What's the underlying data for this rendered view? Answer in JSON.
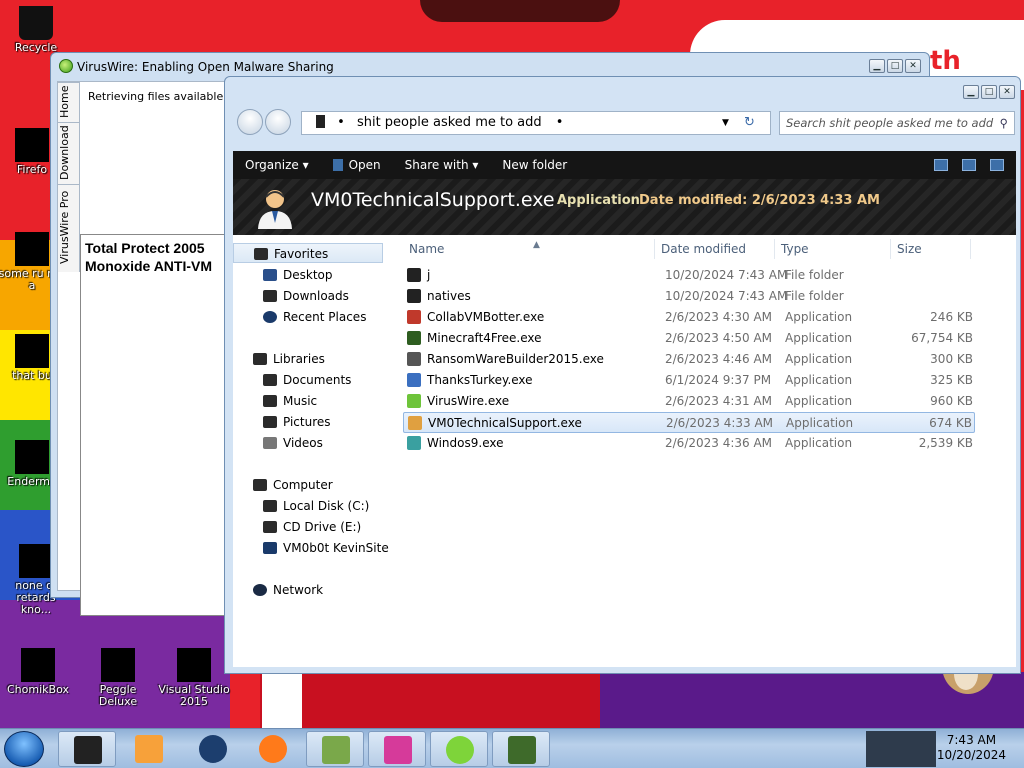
{
  "desktop": {
    "wallpaper_text": "th",
    "icons": [
      {
        "label": "Recycle"
      },
      {
        "label": "Firefo"
      },
      {
        "label": "some ru ran a"
      },
      {
        "label": "that bu"
      },
      {
        "label": "Enderma"
      },
      {
        "label": "none of retards kno..."
      },
      {
        "label": "ChomikBox"
      },
      {
        "label": "Peggle Deluxe"
      },
      {
        "label": "Visual Studio 2015"
      }
    ]
  },
  "viruswire": {
    "title": "VirusWire: Enabling Open Malware Sharing",
    "tabs": [
      "Home",
      "Download",
      "VirusWire Pro"
    ],
    "retrieving": "Retrieving files available, plea",
    "panel_text": "Total Protect 2005\nMonoxide ANTI-VM"
  },
  "explorer": {
    "address": {
      "path": "shit people asked me to add"
    },
    "search_placeholder": "Search shit people asked me to add",
    "toolbar": {
      "organize": "Organize ▾",
      "open": "Open",
      "share_with": "Share with ▾",
      "new_folder": "New folder"
    },
    "details": {
      "filename": "VM0TechnicalSupport.exe",
      "type": "Application",
      "date_modified": "Date modified: 2/6/2023 4:33 AM"
    },
    "nav": {
      "favorites": "Favorites",
      "desktop": "Desktop",
      "downloads": "Downloads",
      "recent": "Recent Places",
      "libraries": "Libraries",
      "documents": "Documents",
      "music": "Music",
      "pictures": "Pictures",
      "videos": "Videos",
      "computer": "Computer",
      "local_disk": "Local Disk (C:)",
      "cd_drive": "CD Drive (E:)",
      "kevinsite": "VM0b0t KevinSite",
      "network": "Network"
    },
    "columns": {
      "name": "Name",
      "date": "Date modified",
      "type": "Type",
      "size": "Size"
    },
    "files": [
      {
        "name": "j",
        "date": "10/20/2024 7:43 AM",
        "type": "File folder",
        "size": "",
        "icon": "folder-icon"
      },
      {
        "name": "natives",
        "date": "10/20/2024 7:43 AM",
        "type": "File folder",
        "size": "",
        "icon": "folder-icon"
      },
      {
        "name": "CollabVMBotter.exe",
        "date": "2/6/2023 4:30 AM",
        "type": "Application",
        "size": "246 KB",
        "icon": "app-icon"
      },
      {
        "name": "Minecraft4Free.exe",
        "date": "2/6/2023 4:50 AM",
        "type": "Application",
        "size": "67,754 KB",
        "icon": "app-icon"
      },
      {
        "name": "RansomWareBuilder2015.exe",
        "date": "2/6/2023 4:46 AM",
        "type": "Application",
        "size": "300 KB",
        "icon": "app-icon"
      },
      {
        "name": "ThanksTurkey.exe",
        "date": "6/1/2024 9:37 PM",
        "type": "Application",
        "size": "325 KB",
        "icon": "app-icon"
      },
      {
        "name": "VirusWire.exe",
        "date": "2/6/2023 4:31 AM",
        "type": "Application",
        "size": "960 KB",
        "icon": "app-icon"
      },
      {
        "name": "VM0TechnicalSupport.exe",
        "date": "2/6/2023 4:33 AM",
        "type": "Application",
        "size": "674 KB",
        "icon": "app-icon",
        "selected": true
      },
      {
        "name": "Windos9.exe",
        "date": "2/6/2023 4:36 AM",
        "type": "Application",
        "size": "2,539 KB",
        "icon": "app-icon"
      }
    ]
  },
  "taskbar": {
    "clock_time": "7:43 AM",
    "clock_date": "10/20/2024"
  }
}
